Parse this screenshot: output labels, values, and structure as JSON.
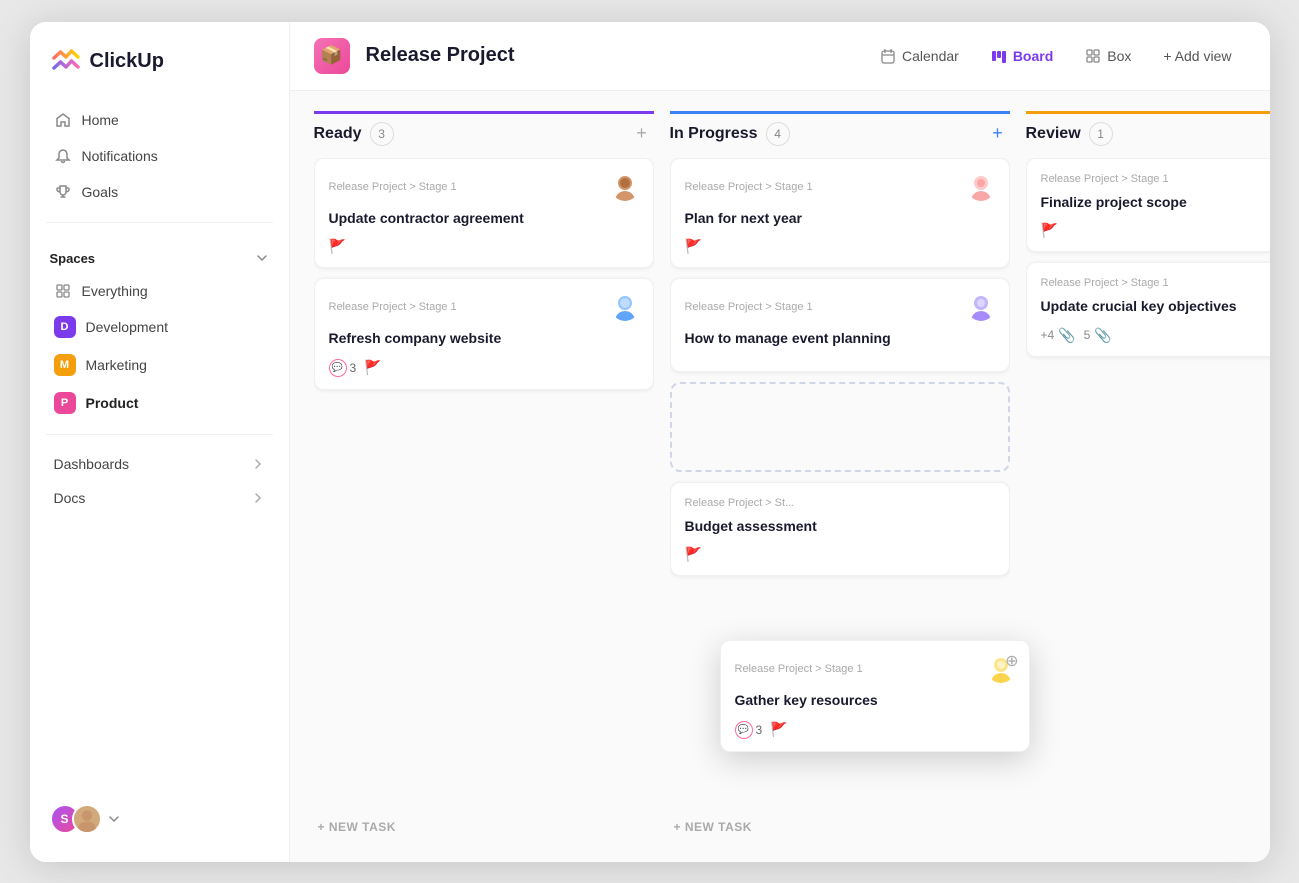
{
  "app": {
    "name": "ClickUp"
  },
  "sidebar": {
    "nav": [
      {
        "id": "home",
        "label": "Home",
        "icon": "home"
      },
      {
        "id": "notifications",
        "label": "Notifications",
        "icon": "bell"
      },
      {
        "id": "goals",
        "label": "Goals",
        "icon": "trophy"
      }
    ],
    "spaces_label": "Spaces",
    "spaces": [
      {
        "id": "everything",
        "label": "Everything",
        "icon": "grid",
        "color": null
      },
      {
        "id": "development",
        "label": "Development",
        "initial": "D",
        "color": "#7c3aed"
      },
      {
        "id": "marketing",
        "label": "Marketing",
        "initial": "M",
        "color": "#f59e0b"
      },
      {
        "id": "product",
        "label": "Product",
        "initial": "P",
        "color": "#ec4899",
        "active": true
      }
    ],
    "bottom_nav": [
      {
        "id": "dashboards",
        "label": "Dashboards"
      },
      {
        "id": "docs",
        "label": "Docs"
      }
    ]
  },
  "header": {
    "project_icon": "📦",
    "project_title": "Release Project",
    "views": [
      {
        "id": "calendar",
        "label": "Calendar",
        "icon": "calendar"
      },
      {
        "id": "board",
        "label": "Board",
        "icon": "board",
        "active": true
      },
      {
        "id": "box",
        "label": "Box",
        "icon": "box"
      }
    ],
    "add_view_label": "+ Add view"
  },
  "columns": [
    {
      "id": "ready",
      "title": "Ready",
      "count": 3,
      "accent": "#7c3aed",
      "cards": [
        {
          "id": "c1",
          "project": "Release Project > Stage 1",
          "title": "Update contractor agreement",
          "flag": "orange",
          "avatar_color": "av-orange"
        },
        {
          "id": "c2",
          "project": "Release Project > Stage 1",
          "title": "Refresh company website",
          "comments": 3,
          "flag": "green",
          "avatar_color": "av-teal"
        }
      ],
      "new_task_label": "+ NEW TASK"
    },
    {
      "id": "inprogress",
      "title": "In Progress",
      "count": 4,
      "accent": "#3b82f6",
      "cards": [
        {
          "id": "c3",
          "project": "Release Project > Stage 1",
          "title": "Plan for next year",
          "flag": "red",
          "avatar_color": "av-red"
        },
        {
          "id": "c4",
          "project": "Release Project > Stage 1",
          "title": "How to manage event planning",
          "flag": null,
          "avatar_color": "av-brown"
        },
        {
          "id": "c4b",
          "dashed": true
        },
        {
          "id": "c5",
          "project": "Release Project > St...",
          "title": "Budget assessment",
          "flag": "orange",
          "avatar_color": null
        }
      ],
      "new_task_label": "+ NEW TASK"
    },
    {
      "id": "review",
      "title": "Review",
      "count": 1,
      "accent": "#f59e0b",
      "cards": [
        {
          "id": "c6",
          "project": "Release Project > Stage 1",
          "title": "Finalize project scope",
          "flag": "red",
          "avatar_color": null
        },
        {
          "id": "c7",
          "project": "Release Project > Stage 1",
          "title": "Update crucial key objectives",
          "flag": null,
          "avatar_color": null,
          "extra_count": "+4",
          "attachments": "5"
        }
      ]
    }
  ],
  "floating_card": {
    "project": "Release Project > Stage 1",
    "title": "Gather key resources",
    "comments": 3,
    "flag": "green",
    "avatar_color": "av-yellow"
  }
}
